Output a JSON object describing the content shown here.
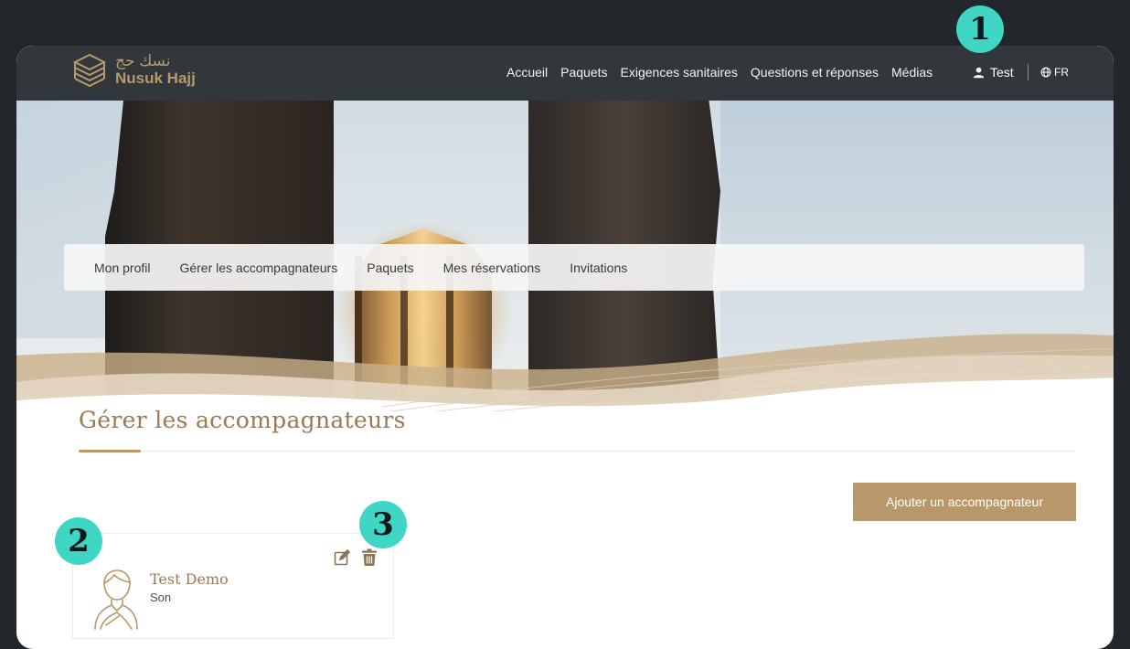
{
  "app": {
    "logo_arabic": "نسك حج",
    "logo_name": "Nusuk Hajj"
  },
  "nav": {
    "items": [
      "Accueil",
      "Paquets",
      "Exigences sanitaires",
      "Questions et réponses",
      "Médias"
    ],
    "user_name": "Test",
    "language": "FR"
  },
  "profile_tabs": [
    "Mon profil",
    "Gérer les accompagnateurs",
    "Paquets",
    "Mes réservations",
    "Invitations"
  ],
  "page": {
    "title": "Gérer les accompagnateurs",
    "add_button": "Ajouter un accompagnateur"
  },
  "companions": [
    {
      "name": "Test Demo",
      "relation": "Son"
    }
  ],
  "annotations": [
    "1",
    "2",
    "3"
  ],
  "colors": {
    "accent": "#b8976a",
    "title": "#9a7a52",
    "badge": "#3fd6c6",
    "topbar": "#262a2e"
  },
  "icons": [
    "user-icon",
    "globe-icon",
    "edit-icon",
    "trash-icon",
    "avatar-icon",
    "kaaba-logo-icon"
  ]
}
